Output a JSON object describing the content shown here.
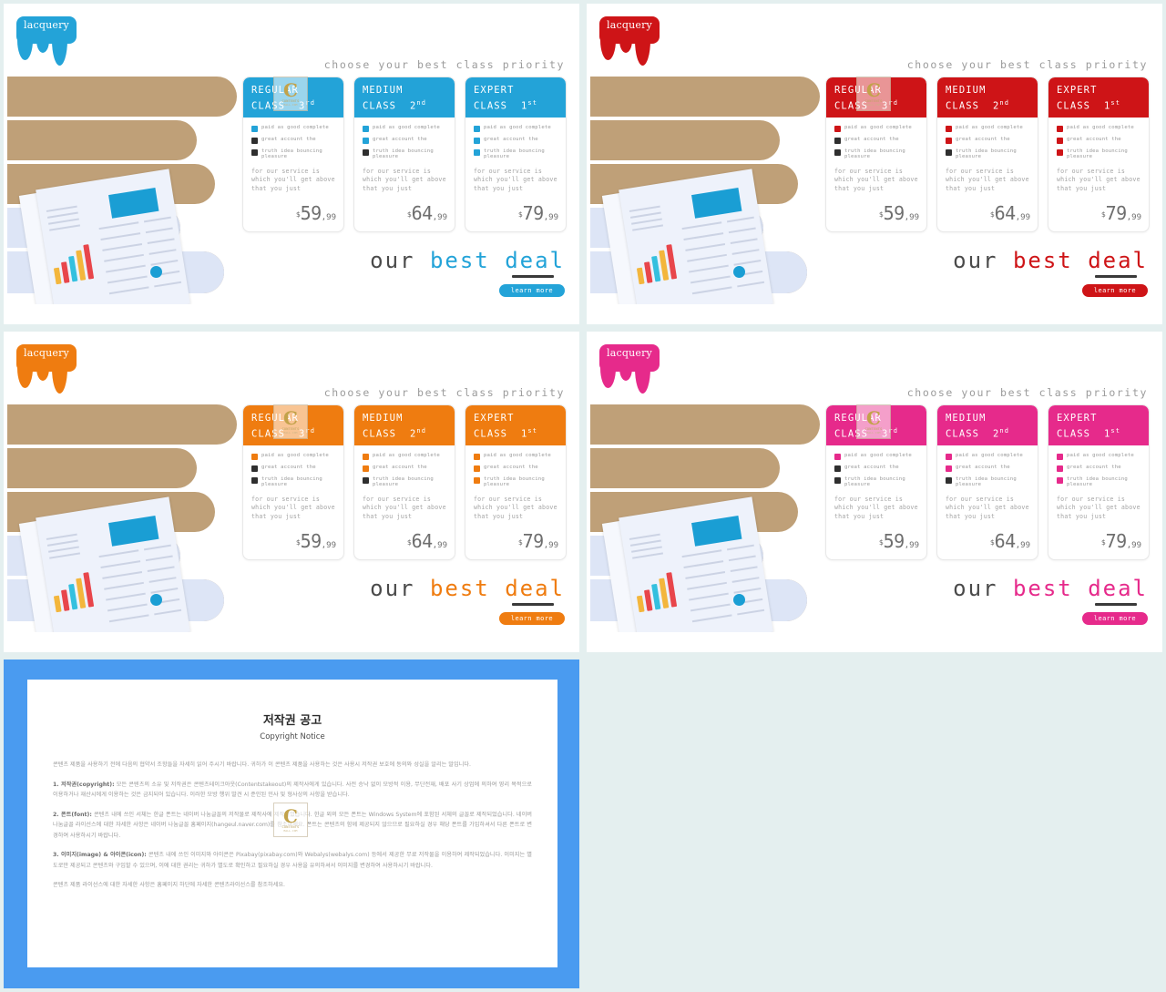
{
  "theme": {
    "page_background": "#e4efef",
    "panel_background": "#ffffff"
  },
  "slides": [
    {
      "id": "blue",
      "accent": "#23a3d8",
      "dark": "#2f2f2f",
      "logo_text": "lacquery",
      "tagline": "choose your best class priority",
      "deal_prefix": "our",
      "deal_accent_text": "best deal",
      "learn_more": "learn more",
      "cards": [
        {
          "title_line1": "REGULAR",
          "title_line2": "CLASS",
          "rank": "3",
          "rank_suffix": "rd",
          "features": [
            {
              "text": "paid as good complete",
              "filled": true
            },
            {
              "text": "great account the",
              "filled": false
            },
            {
              "text": "truth idea bouncing pleasure",
              "filled": false
            }
          ],
          "description": "for our service is which you'll get above that you just",
          "currency": "$",
          "amount": "59",
          "cents": ",99"
        },
        {
          "title_line1": "MEDIUM",
          "title_line2": "CLASS",
          "rank": "2",
          "rank_suffix": "nd",
          "features": [
            {
              "text": "paid as good complete",
              "filled": true
            },
            {
              "text": "great account the",
              "filled": true
            },
            {
              "text": "truth idea bouncing pleasure",
              "filled": false
            }
          ],
          "description": "for our service is which you'll get above that you just",
          "currency": "$",
          "amount": "64",
          "cents": ",99"
        },
        {
          "title_line1": "EXPERT",
          "title_line2": "CLASS",
          "rank": "1",
          "rank_suffix": "st",
          "features": [
            {
              "text": "paid as good complete",
              "filled": true
            },
            {
              "text": "great account the",
              "filled": true
            },
            {
              "text": "truth idea bouncing pleasure",
              "filled": true
            }
          ],
          "description": "for our service is which you'll get above that you just",
          "currency": "$",
          "amount": "79",
          "cents": ",99"
        }
      ]
    },
    {
      "id": "red",
      "accent": "#ce1417",
      "dark": "#2f2f2f",
      "logo_text": "lacquery",
      "tagline": "choose your best class priority",
      "deal_prefix": "our",
      "deal_accent_text": "best deal",
      "learn_more": "learn more",
      "cards": [
        {
          "title_line1": "REGULAR",
          "title_line2": "CLASS",
          "rank": "3",
          "rank_suffix": "rd",
          "features": [
            {
              "text": "paid as good complete",
              "filled": true
            },
            {
              "text": "great account the",
              "filled": false
            },
            {
              "text": "truth idea bouncing pleasure",
              "filled": false
            }
          ],
          "description": "for our service is which you'll get above that you just",
          "currency": "$",
          "amount": "59",
          "cents": ",99"
        },
        {
          "title_line1": "MEDIUM",
          "title_line2": "CLASS",
          "rank": "2",
          "rank_suffix": "nd",
          "features": [
            {
              "text": "paid as good complete",
              "filled": true
            },
            {
              "text": "great account the",
              "filled": true
            },
            {
              "text": "truth idea bouncing pleasure",
              "filled": false
            }
          ],
          "description": "for our service is which you'll get above that you just",
          "currency": "$",
          "amount": "64",
          "cents": ",99"
        },
        {
          "title_line1": "EXPERT",
          "title_line2": "CLASS",
          "rank": "1",
          "rank_suffix": "st",
          "features": [
            {
              "text": "paid as good complete",
              "filled": true
            },
            {
              "text": "great account the",
              "filled": true
            },
            {
              "text": "truth idea bouncing pleasure",
              "filled": true
            }
          ],
          "description": "for our service is which you'll get above that you just",
          "currency": "$",
          "amount": "79",
          "cents": ",99"
        }
      ]
    },
    {
      "id": "orange",
      "accent": "#ef7c10",
      "dark": "#2f2f2f",
      "logo_text": "lacquery",
      "tagline": "choose your best class priority",
      "deal_prefix": "our",
      "deal_accent_text": "best deal",
      "learn_more": "learn more",
      "cards": [
        {
          "title_line1": "REGULAR",
          "title_line2": "CLASS",
          "rank": "3",
          "rank_suffix": "rd",
          "features": [
            {
              "text": "paid as good complete",
              "filled": true
            },
            {
              "text": "great account the",
              "filled": false
            },
            {
              "text": "truth idea bouncing pleasure",
              "filled": false
            }
          ],
          "description": "for our service is which you'll get above that you just",
          "currency": "$",
          "amount": "59",
          "cents": ",99"
        },
        {
          "title_line1": "MEDIUM",
          "title_line2": "CLASS",
          "rank": "2",
          "rank_suffix": "nd",
          "features": [
            {
              "text": "paid as good complete",
              "filled": true
            },
            {
              "text": "great account the",
              "filled": true
            },
            {
              "text": "truth idea bouncing pleasure",
              "filled": false
            }
          ],
          "description": "for our service is which you'll get above that you just",
          "currency": "$",
          "amount": "64",
          "cents": ",99"
        },
        {
          "title_line1": "EXPERT",
          "title_line2": "CLASS",
          "rank": "1",
          "rank_suffix": "st",
          "features": [
            {
              "text": "paid as good complete",
              "filled": true
            },
            {
              "text": "great account the",
              "filled": true
            },
            {
              "text": "truth idea bouncing pleasure",
              "filled": true
            }
          ],
          "description": "for our service is which you'll get above that you just",
          "currency": "$",
          "amount": "79",
          "cents": ",99"
        }
      ]
    },
    {
      "id": "pink",
      "accent": "#e62a8b",
      "dark": "#2f2f2f",
      "logo_text": "lacquery",
      "tagline": "choose your best class priority",
      "deal_prefix": "our",
      "deal_accent_text": "best deal",
      "learn_more": "learn more",
      "cards": [
        {
          "title_line1": "REGULAR",
          "title_line2": "CLASS",
          "rank": "3",
          "rank_suffix": "rd",
          "features": [
            {
              "text": "paid as good complete",
              "filled": true
            },
            {
              "text": "great account the",
              "filled": false
            },
            {
              "text": "truth idea bouncing pleasure",
              "filled": false
            }
          ],
          "description": "for our service is which you'll get above that you just",
          "currency": "$",
          "amount": "59",
          "cents": ",99"
        },
        {
          "title_line1": "MEDIUM",
          "title_line2": "CLASS",
          "rank": "2",
          "rank_suffix": "nd",
          "features": [
            {
              "text": "paid as good complete",
              "filled": true
            },
            {
              "text": "great account the",
              "filled": true
            },
            {
              "text": "truth idea bouncing pleasure",
              "filled": false
            }
          ],
          "description": "for our service is which you'll get above that you just",
          "currency": "$",
          "amount": "64",
          "cents": ",99"
        },
        {
          "title_line1": "EXPERT",
          "title_line2": "CLASS",
          "rank": "1",
          "rank_suffix": "st",
          "features": [
            {
              "text": "paid as good complete",
              "filled": true
            },
            {
              "text": "great account the",
              "filled": true
            },
            {
              "text": "truth idea bouncing pleasure",
              "filled": true
            }
          ],
          "description": "for our service is which you'll get above that you just",
          "currency": "$",
          "amount": "79",
          "cents": ",99"
        }
      ]
    }
  ],
  "watermark": {
    "letter": "C",
    "line1": "CONTENTS",
    "line2": "MALL.COM"
  },
  "copyright_slide": {
    "background": "#4a9bf0",
    "title_ko": "저작권 공고",
    "title_en": "Copyright Notice",
    "intro": "콘텐츠 제품을 사용하기 전에 다음의 협약서 조항들을 자세히 읽어 주시기 바랍니다. 귀하가 이 콘텐츠 제품을 사용하는 것은 사용시 저작권 보호에 동의와 성실을 알리는 말입니다.",
    "sections": [
      {
        "label": "1. 저작권(copyright):",
        "text": "모든 콘텐츠의 소유 및 저작권은 콘텐츠테이크아웃(Contentstakeout)의 제작사에게 있습니다. 사전 승낙 없이 모방적 이용, 무단전재, 배포 사기 상업에 의하여 영리 목적으로 이용하거나 재산시에게 이용하는 것은 금지되어 있습니다. 이러한 모방 행위 발견 시 준인된 민사 및 형사상의 사항을 받습니다."
      },
      {
        "label": "2. 폰트(font):",
        "text": "콘텐츠 내에 쓰인 서체는 한글 폰트는 네이버 나눔글꼴의 저작물로 제작사에 제작되었습니다. 한글 외의 모든 폰트는 Windows System에 포함된 서체의 글꼴로 제작되었습니다. 네이버 나눔글꼴 라이선스에 대한 자세한 사항은 네이버 나눔글꼴 홈페이지(hangeul.naver.com)를 참조하세요. 폰트는 콘텐츠의 함께 제공되지 않으므로 필요하실 경우 해당 폰트를 가입하셔서 다른 폰트로 변경하여 사용하시기 바랍니다."
      },
      {
        "label": "3. 이미지(image) & 아이콘(icon):",
        "text": "콘텐츠 내에 쓰인 이미지와 아이콘은 Pixabay(pixabay.com)와 Webalys(webalys.com) 등에서 제공한 무료 저작물을 이용하여 제작되었습니다. 이미지는 별도로만 제공되고 콘텐츠와 구입할 수 있으며, 이에 대한 권리는 귀하가 별도로 확인하고 필요하실 경우 사용을 유의하셔서 이미지를 변경하여 사용하시기 바랍니다."
      }
    ],
    "footer": "콘텐츠 제품 라이선스에 대한 자세한 사항은 홈페이지 하단에 자세한 콘텐츠라이선스를 참조하세요."
  }
}
